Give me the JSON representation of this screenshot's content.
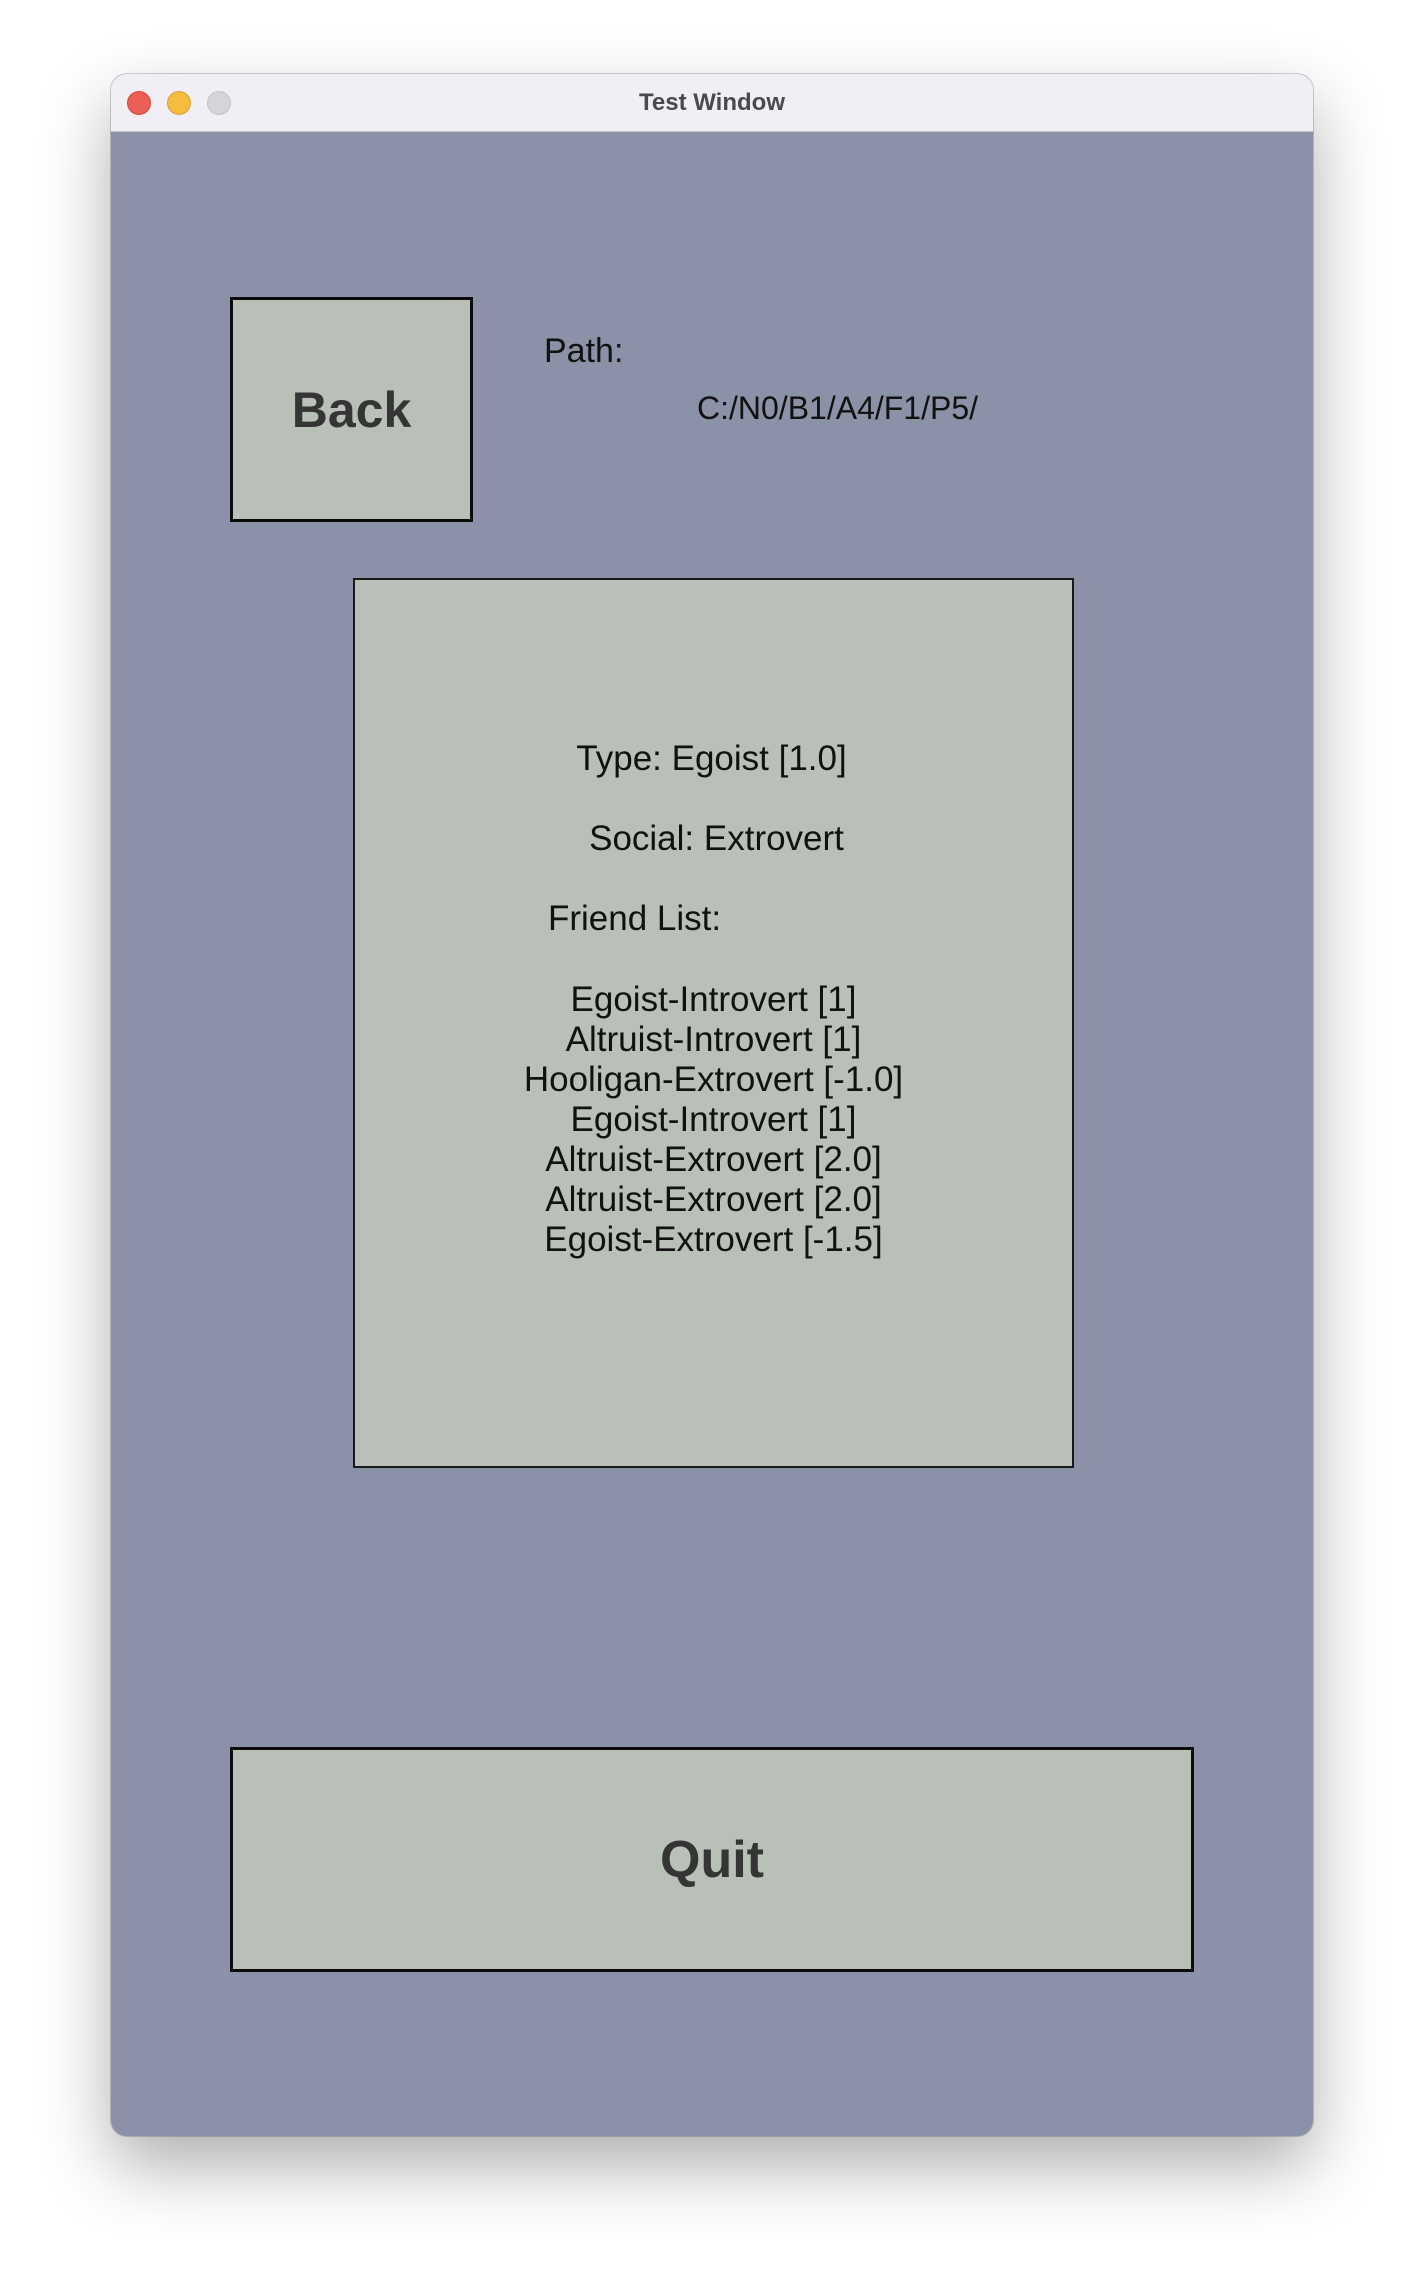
{
  "window": {
    "title": "Test Window"
  },
  "buttons": {
    "back_label": "Back",
    "quit_label": "Quit"
  },
  "path": {
    "label": "Path:",
    "value": "C:/N0/B1/A4/F1/P5/"
  },
  "info": {
    "type_line": "Type: Egoist [1.0]",
    "social_line": "Social: Extrovert",
    "friend_list_label": "Friend List:",
    "friends": [
      "Egoist-Introvert [1]",
      "Altruist-Introvert [1]",
      "Hooligan-Extrovert [-1.0]",
      "Egoist-Introvert [1]",
      "Altruist-Extrovert [2.0]",
      "Altruist-Extrovert [2.0]",
      "Egoist-Extrovert [-1.5]"
    ]
  },
  "colors": {
    "window_background": "#8b91a6",
    "panel_background": "#b8c0b7",
    "titlebar_background": "#f1eff5",
    "close_button": "#ec5f57",
    "minimize_button": "#f4bd3f",
    "zoom_button": "#d6d4d9"
  }
}
